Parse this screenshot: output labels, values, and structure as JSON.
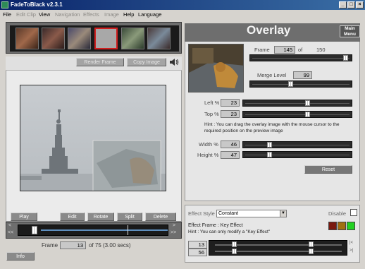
{
  "window": {
    "title": "FadeToBlack v2.3.1",
    "controls": [
      "_",
      "□",
      "×"
    ]
  },
  "menu": [
    {
      "label": "File",
      "enabled": true
    },
    {
      "label": "Edit Clip",
      "enabled": false
    },
    {
      "label": "View",
      "enabled": true
    },
    {
      "label": "Navigation",
      "enabled": false
    },
    {
      "label": "Effects",
      "enabled": false
    },
    {
      "label": "Image",
      "enabled": false
    },
    {
      "label": "Help",
      "enabled": true
    },
    {
      "label": "Language",
      "enabled": true
    }
  ],
  "preview": {
    "render_label": "Render Frame",
    "copy_label": "Copy Image",
    "sound_icon": "speaker-icon"
  },
  "clip_buttons": {
    "play": "Play",
    "edit": "Edit",
    "rotate": "Rotate",
    "split": "Split",
    "delete": "Delete"
  },
  "timeline": {
    "prev": "<",
    "next": ">",
    "first": "<<",
    "last": ">>",
    "position": 0.09
  },
  "frame": {
    "label": "Frame",
    "value": "13",
    "info": "of 75 (3.00 secs)"
  },
  "info_label": "Info",
  "overlay": {
    "title": "Overlay",
    "main_menu": "Main\nMenu",
    "frame_label": "Frame",
    "frame_value": "145",
    "frame_of": "of",
    "frame_total": "150",
    "frame_pos": 0.97,
    "merge_label": "Merge Level",
    "merge_value": "99",
    "merge_pos": 0.39,
    "left_label": "Left %",
    "left_value": "23",
    "left_pos": 0.6,
    "top_label": "Top %",
    "top_value": "23",
    "top_pos": 0.6,
    "hint": "Hint : You can drag the overlay image with the mouse cursor to the required position on the preview image",
    "width_label": "Width %",
    "width_value": "46",
    "width_pos": 0.23,
    "height_label": "Height %",
    "height_value": "47",
    "height_pos": 0.23,
    "reset_label": "Reset"
  },
  "effect": {
    "style_label": "Effect Style",
    "style_value": "Constant",
    "disable_label": "Disable",
    "frame_info": "Effect Frame : Key Effect",
    "hint": "Hint : You can only modify a \"Key Effect\"",
    "start_value": "13",
    "end_value": "56",
    "btn_prev": "|<",
    "btn_next": ">|",
    "colors": {
      "red": "#7a1a10",
      "orange": "#a07010",
      "green": "#22d022"
    }
  }
}
